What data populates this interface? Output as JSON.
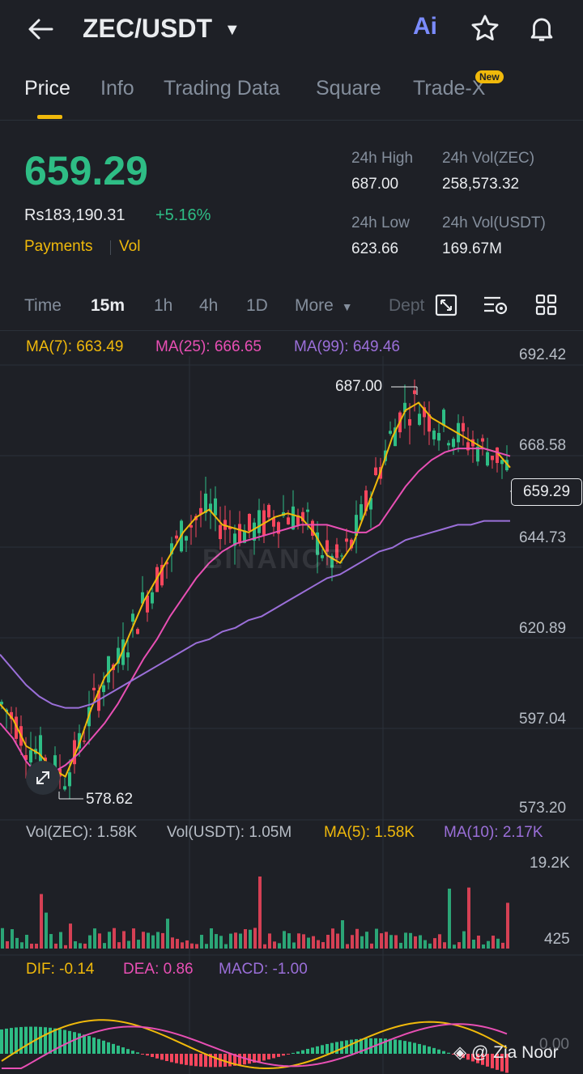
{
  "header": {
    "pair": "ZEC/USDT",
    "ai_label": "Ai"
  },
  "tabs": [
    {
      "label": "Price",
      "active": true
    },
    {
      "label": "Info"
    },
    {
      "label": "Trading Data"
    },
    {
      "label": "Square"
    },
    {
      "label": "Trade-X",
      "badge": "New"
    }
  ],
  "price": {
    "last": "659.29",
    "local": "Rs183,190.31",
    "change": "+5.16%",
    "payments": "Payments",
    "vol": "Vol"
  },
  "stats": {
    "high_label": "24h High",
    "high": "687.00",
    "vol_zec_label": "24h Vol(ZEC)",
    "vol_zec": "258,573.32",
    "low_label": "24h Low",
    "low": "623.66",
    "vol_usdt_label": "24h Vol(USDT)",
    "vol_usdt": "169.67M"
  },
  "timeframes": [
    "Time",
    "15m",
    "1h",
    "4h",
    "1D",
    "More",
    "Dept"
  ],
  "timeframe_active": "15m",
  "ma_legend": {
    "ma7": "MA(7): 663.49",
    "ma25": "MA(25): 666.65",
    "ma99": "MA(99): 649.46"
  },
  "price_axis": [
    "692.42",
    "668.58",
    "644.73",
    "620.89",
    "597.04",
    "573.20"
  ],
  "current_tag": "659.29",
  "high_marker": "687.00",
  "low_marker": "578.62",
  "watermark": "BINANCE",
  "volume": {
    "zec": "Vol(ZEC): 1.58K",
    "usdt": "Vol(USDT): 1.05M",
    "ma5": "MA(5): 1.58K",
    "ma10": "MA(10): 2.17K",
    "axis_top": "19.2K",
    "axis_bottom": "425"
  },
  "macd": {
    "dif": "DIF: -0.14",
    "dea": "DEA: 0.86",
    "macd": "MACD: -1.00",
    "axis": "0.00"
  },
  "credit": "@ Zia Noor",
  "colors": {
    "up": "#2ebd85",
    "down": "#f6465d",
    "ma7": "#f0b90b",
    "ma25": "#e84fb4",
    "ma99": "#9b6fd9",
    "accent": "#f0b90b"
  },
  "chart_data": {
    "type": "line",
    "title": "",
    "ylim": [
      573.2,
      692.42
    ],
    "series": [
      {
        "name": "MA(7)",
        "values": [
          601,
          597,
          590,
          588,
          584,
          582,
          590,
          600,
          608,
          612,
          620,
          628,
          634,
          640,
          646,
          650,
          652,
          648,
          647,
          646,
          648,
          650,
          651,
          650,
          646,
          640,
          638,
          643,
          652,
          661,
          671,
          678,
          680,
          676,
          674,
          672,
          670,
          668,
          667,
          663
        ]
      },
      {
        "name": "MA(25)",
        "values": [
          596,
          592,
          586,
          582,
          583,
          585,
          588,
          592,
          596,
          601,
          607,
          613,
          618,
          624,
          629,
          634,
          638,
          641,
          643,
          644,
          645,
          646,
          647,
          648,
          648,
          648,
          647,
          646,
          646,
          648,
          653,
          658,
          662,
          665,
          667,
          668,
          668,
          668,
          667,
          666
        ]
      },
      {
        "name": "MA(99)",
        "values": [
          614,
          610,
          606,
          603,
          601,
          600,
          600,
          601,
          603,
          605,
          607,
          609,
          611,
          613,
          615,
          617,
          618,
          620,
          621,
          623,
          624,
          626,
          628,
          630,
          632,
          634,
          635,
          637,
          639,
          641,
          642,
          644,
          645,
          646,
          647,
          648,
          648,
          649,
          649,
          649
        ]
      }
    ]
  }
}
